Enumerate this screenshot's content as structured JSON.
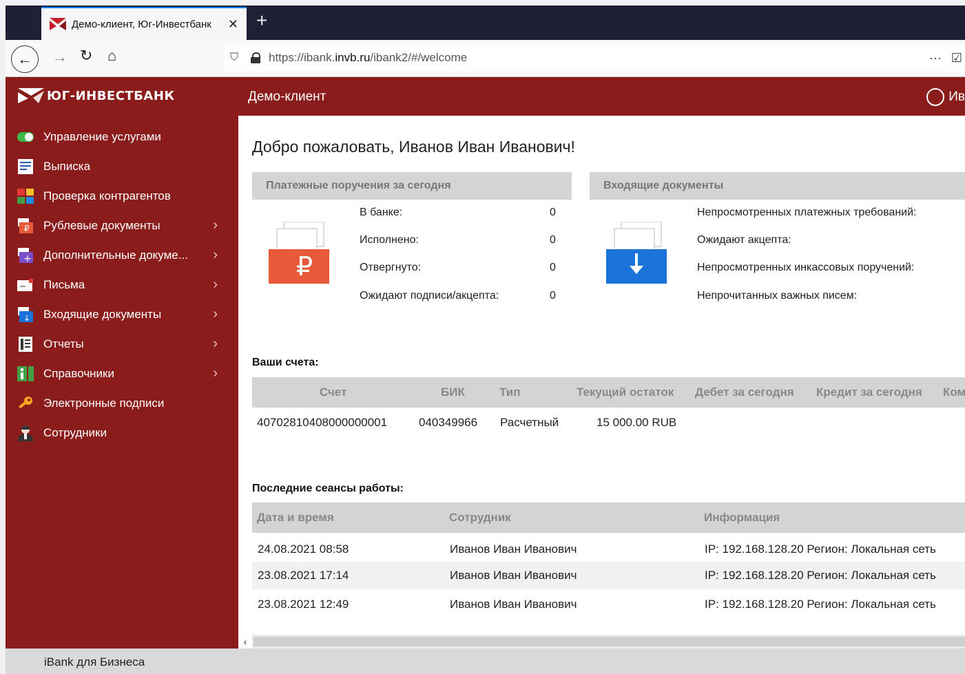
{
  "browser": {
    "tab_title": "Демо-клиент, Юг-Инвестбанк",
    "new_tab": "+",
    "url_prefix": "https://ibank.",
    "url_domain": "invb.ru",
    "url_suffix": "/ibank2/#/welcome"
  },
  "header": {
    "logo_text": "ЮГ-ИНВЕСТБАНК",
    "client_name": "Демо-клиент",
    "user_short": "Ив"
  },
  "sidebar": {
    "items": [
      {
        "label": "Управление услугами",
        "icon": "toggle-icon",
        "chevron": false
      },
      {
        "label": "Выписка",
        "icon": "statement-icon",
        "chevron": false
      },
      {
        "label": "Проверка контрагентов",
        "icon": "counterparty-check-icon",
        "chevron": false
      },
      {
        "label": "Рублевые документы",
        "icon": "ruble-docs-icon",
        "chevron": true
      },
      {
        "label": "Дополнительные докуме...",
        "icon": "additional-docs-icon",
        "chevron": true
      },
      {
        "label": "Письма",
        "icon": "letters-icon",
        "chevron": true
      },
      {
        "label": "Входящие документы",
        "icon": "incoming-docs-icon",
        "chevron": true
      },
      {
        "label": "Отчеты",
        "icon": "reports-icon",
        "chevron": true
      },
      {
        "label": "Справочники",
        "icon": "directories-icon",
        "chevron": true
      },
      {
        "label": "Электронные подписи",
        "icon": "key-icon",
        "chevron": false
      },
      {
        "label": "Сотрудники",
        "icon": "employee-icon",
        "chevron": false
      }
    ]
  },
  "main": {
    "welcome": "Добро пожаловать, Иванов Иван Иванович!",
    "payments_panel": {
      "title": "Платежные поручения за сегодня",
      "stats": [
        {
          "label": "В банке:",
          "value": "0"
        },
        {
          "label": "Исполнено:",
          "value": "0"
        },
        {
          "label": "Отвергнуто:",
          "value": "0"
        },
        {
          "label": "Ожидают подписи/акцепта:",
          "value": "0"
        }
      ]
    },
    "incoming_panel": {
      "title": "Входящие документы",
      "stats": [
        {
          "label": "Непросмотренных платежных требований:"
        },
        {
          "label": "Ожидают акцепта:"
        },
        {
          "label": "Непросмотренных инкассовых поручений:"
        },
        {
          "label": "Непрочитанных важных писем:"
        }
      ]
    },
    "accounts": {
      "title": "Ваши счета:",
      "columns": [
        "Счет",
        "БИК",
        "Тип",
        "Текущий остаток",
        "Дебет за сегодня",
        "Кредит за сегодня",
        "Ком"
      ],
      "rows": [
        {
          "account": "40702810408000000001",
          "bik": "040349966",
          "type": "Расчетный",
          "balance": "15 000.00 RUB"
        }
      ]
    },
    "sessions": {
      "title": "Последние сеансы работы:",
      "columns": [
        "Дата и время",
        "Сотрудник",
        "Информация"
      ],
      "rows": [
        {
          "datetime": "24.08.2021 08:58",
          "employee": "Иванов Иван Иванович",
          "info": "IP: 192.168.128.20 Регион: Локальная сеть"
        },
        {
          "datetime": "23.08.2021 17:14",
          "employee": "Иванов Иван Иванович",
          "info": "IP: 192.168.128.20 Регион: Локальная сеть"
        },
        {
          "datetime": "23.08.2021 12:49",
          "employee": "Иванов Иван Иванович",
          "info": "IP: 192.168.128.20 Регион: Локальная сеть"
        }
      ]
    }
  },
  "footer": {
    "text": "iBank для Бизнеса"
  },
  "colors": {
    "brand": "#8b1c1c",
    "payments_icon": "#e8593a",
    "incoming_icon": "#1a73d9"
  }
}
